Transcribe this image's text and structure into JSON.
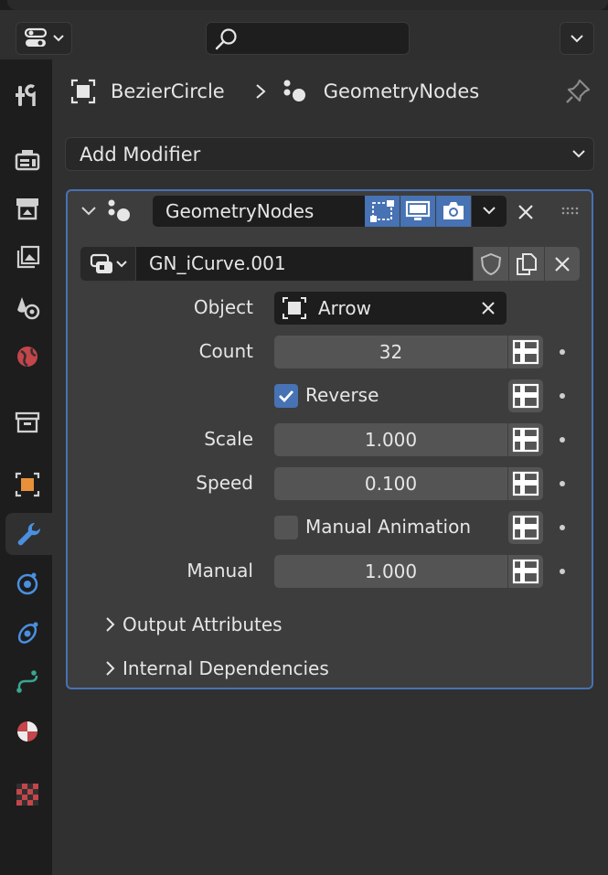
{
  "breadcrumb": {
    "object": "BezierCircle",
    "modifier": "GeometryNodes"
  },
  "add_modifier": {
    "label": "Add Modifier"
  },
  "modifier": {
    "name": "GeometryNodes",
    "node_group": "GN_iCurve.001",
    "props": {
      "object_label": "Object",
      "object_value": "Arrow",
      "count_label": "Count",
      "count_value": "32",
      "reverse_label": "Reverse",
      "reverse_checked": true,
      "scale_label": "Scale",
      "scale_value": "1.000",
      "speed_label": "Speed",
      "speed_value": "0.100",
      "manual_anim_label": "Manual Animation",
      "manual_anim_checked": false,
      "manual_label": "Manual",
      "manual_value": "1.000"
    },
    "subpanels": {
      "output_attributes": "Output Attributes",
      "internal_dependencies": "Internal Dependencies"
    }
  },
  "colors": {
    "accent": "#4772b3",
    "panel_bg": "#3d3d3d",
    "field_bg": "#1d1d1d",
    "num_bg": "#545454"
  },
  "toolbar_tabs": [
    "tool-icon",
    "render-icon",
    "output-icon",
    "view-layer-icon",
    "scene-icon",
    "world-icon",
    "collection-icon",
    "object-icon",
    "modifier-icon",
    "particles-icon",
    "physics-icon",
    "constraints-icon",
    "data-icon",
    "material-icon",
    "texture-icon"
  ]
}
